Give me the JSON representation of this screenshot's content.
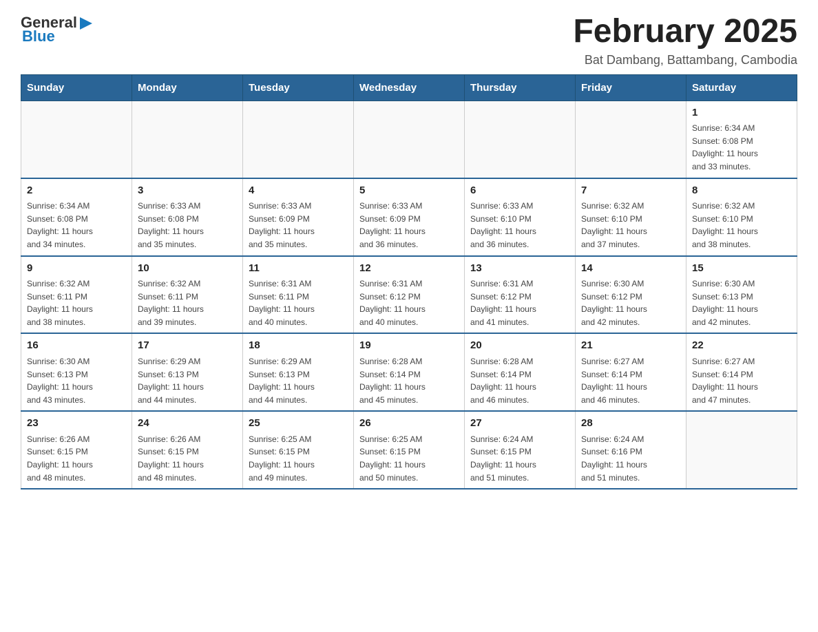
{
  "header": {
    "logo": {
      "general": "General",
      "blue": "Blue"
    },
    "title": "February 2025",
    "subtitle": "Bat Dambang, Battambang, Cambodia"
  },
  "calendar": {
    "days_of_week": [
      "Sunday",
      "Monday",
      "Tuesday",
      "Wednesday",
      "Thursday",
      "Friday",
      "Saturday"
    ],
    "weeks": [
      [
        {
          "day": "",
          "info": ""
        },
        {
          "day": "",
          "info": ""
        },
        {
          "day": "",
          "info": ""
        },
        {
          "day": "",
          "info": ""
        },
        {
          "day": "",
          "info": ""
        },
        {
          "day": "",
          "info": ""
        },
        {
          "day": "1",
          "info": "Sunrise: 6:34 AM\nSunset: 6:08 PM\nDaylight: 11 hours\nand 33 minutes."
        }
      ],
      [
        {
          "day": "2",
          "info": "Sunrise: 6:34 AM\nSunset: 6:08 PM\nDaylight: 11 hours\nand 34 minutes."
        },
        {
          "day": "3",
          "info": "Sunrise: 6:33 AM\nSunset: 6:08 PM\nDaylight: 11 hours\nand 35 minutes."
        },
        {
          "day": "4",
          "info": "Sunrise: 6:33 AM\nSunset: 6:09 PM\nDaylight: 11 hours\nand 35 minutes."
        },
        {
          "day": "5",
          "info": "Sunrise: 6:33 AM\nSunset: 6:09 PM\nDaylight: 11 hours\nand 36 minutes."
        },
        {
          "day": "6",
          "info": "Sunrise: 6:33 AM\nSunset: 6:10 PM\nDaylight: 11 hours\nand 36 minutes."
        },
        {
          "day": "7",
          "info": "Sunrise: 6:32 AM\nSunset: 6:10 PM\nDaylight: 11 hours\nand 37 minutes."
        },
        {
          "day": "8",
          "info": "Sunrise: 6:32 AM\nSunset: 6:10 PM\nDaylight: 11 hours\nand 38 minutes."
        }
      ],
      [
        {
          "day": "9",
          "info": "Sunrise: 6:32 AM\nSunset: 6:11 PM\nDaylight: 11 hours\nand 38 minutes."
        },
        {
          "day": "10",
          "info": "Sunrise: 6:32 AM\nSunset: 6:11 PM\nDaylight: 11 hours\nand 39 minutes."
        },
        {
          "day": "11",
          "info": "Sunrise: 6:31 AM\nSunset: 6:11 PM\nDaylight: 11 hours\nand 40 minutes."
        },
        {
          "day": "12",
          "info": "Sunrise: 6:31 AM\nSunset: 6:12 PM\nDaylight: 11 hours\nand 40 minutes."
        },
        {
          "day": "13",
          "info": "Sunrise: 6:31 AM\nSunset: 6:12 PM\nDaylight: 11 hours\nand 41 minutes."
        },
        {
          "day": "14",
          "info": "Sunrise: 6:30 AM\nSunset: 6:12 PM\nDaylight: 11 hours\nand 42 minutes."
        },
        {
          "day": "15",
          "info": "Sunrise: 6:30 AM\nSunset: 6:13 PM\nDaylight: 11 hours\nand 42 minutes."
        }
      ],
      [
        {
          "day": "16",
          "info": "Sunrise: 6:30 AM\nSunset: 6:13 PM\nDaylight: 11 hours\nand 43 minutes."
        },
        {
          "day": "17",
          "info": "Sunrise: 6:29 AM\nSunset: 6:13 PM\nDaylight: 11 hours\nand 44 minutes."
        },
        {
          "day": "18",
          "info": "Sunrise: 6:29 AM\nSunset: 6:13 PM\nDaylight: 11 hours\nand 44 minutes."
        },
        {
          "day": "19",
          "info": "Sunrise: 6:28 AM\nSunset: 6:14 PM\nDaylight: 11 hours\nand 45 minutes."
        },
        {
          "day": "20",
          "info": "Sunrise: 6:28 AM\nSunset: 6:14 PM\nDaylight: 11 hours\nand 46 minutes."
        },
        {
          "day": "21",
          "info": "Sunrise: 6:27 AM\nSunset: 6:14 PM\nDaylight: 11 hours\nand 46 minutes."
        },
        {
          "day": "22",
          "info": "Sunrise: 6:27 AM\nSunset: 6:14 PM\nDaylight: 11 hours\nand 47 minutes."
        }
      ],
      [
        {
          "day": "23",
          "info": "Sunrise: 6:26 AM\nSunset: 6:15 PM\nDaylight: 11 hours\nand 48 minutes."
        },
        {
          "day": "24",
          "info": "Sunrise: 6:26 AM\nSunset: 6:15 PM\nDaylight: 11 hours\nand 48 minutes."
        },
        {
          "day": "25",
          "info": "Sunrise: 6:25 AM\nSunset: 6:15 PM\nDaylight: 11 hours\nand 49 minutes."
        },
        {
          "day": "26",
          "info": "Sunrise: 6:25 AM\nSunset: 6:15 PM\nDaylight: 11 hours\nand 50 minutes."
        },
        {
          "day": "27",
          "info": "Sunrise: 6:24 AM\nSunset: 6:15 PM\nDaylight: 11 hours\nand 51 minutes."
        },
        {
          "day": "28",
          "info": "Sunrise: 6:24 AM\nSunset: 6:16 PM\nDaylight: 11 hours\nand 51 minutes."
        },
        {
          "day": "",
          "info": ""
        }
      ]
    ]
  }
}
